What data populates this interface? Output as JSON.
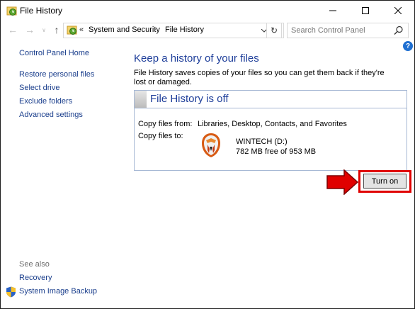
{
  "window": {
    "title": "File History",
    "minimize_glyph": "—",
    "maximize_glyph": "☐",
    "close_glyph": "✕"
  },
  "nav": {
    "back_glyph": "←",
    "forward_glyph": "→",
    "recent_glyph": "∨",
    "up_glyph": "↑",
    "address_prefix": "«",
    "breadcrumb": [
      "System and Security",
      "File History"
    ],
    "breadcrumb_separator": "›",
    "refresh_glyph": "↻",
    "search_placeholder": "Search Control Panel"
  },
  "sidebar": {
    "home": "Control Panel Home",
    "links": [
      "Restore personal files",
      "Select drive",
      "Exclude folders",
      "Advanced settings"
    ],
    "see_also_heading": "See also",
    "see_also": [
      "Recovery",
      "System Image Backup"
    ]
  },
  "help_glyph": "?",
  "main": {
    "title": "Keep a history of your files",
    "description": "File History saves copies of your files so you can get them back if they're lost or damaged.",
    "status_title": "File History is off",
    "copy_from_label": "Copy files from:",
    "copy_from_value": "Libraries, Desktop, Contacts, and Favorites",
    "copy_to_label": "Copy files to:",
    "drive_name": "WINTECH (D:)",
    "drive_free": "782 MB free of 953 MB",
    "turn_on_label": "Turn on"
  },
  "colors": {
    "link": "#1a3e8c",
    "heading": "#1e3e9a",
    "highlight": "#e00000",
    "box_border": "#a6b8d4"
  },
  "icons": [
    "file-history-icon",
    "search-icon",
    "help-icon",
    "shield-icon",
    "drive-icon",
    "red-arrow-icon"
  ]
}
